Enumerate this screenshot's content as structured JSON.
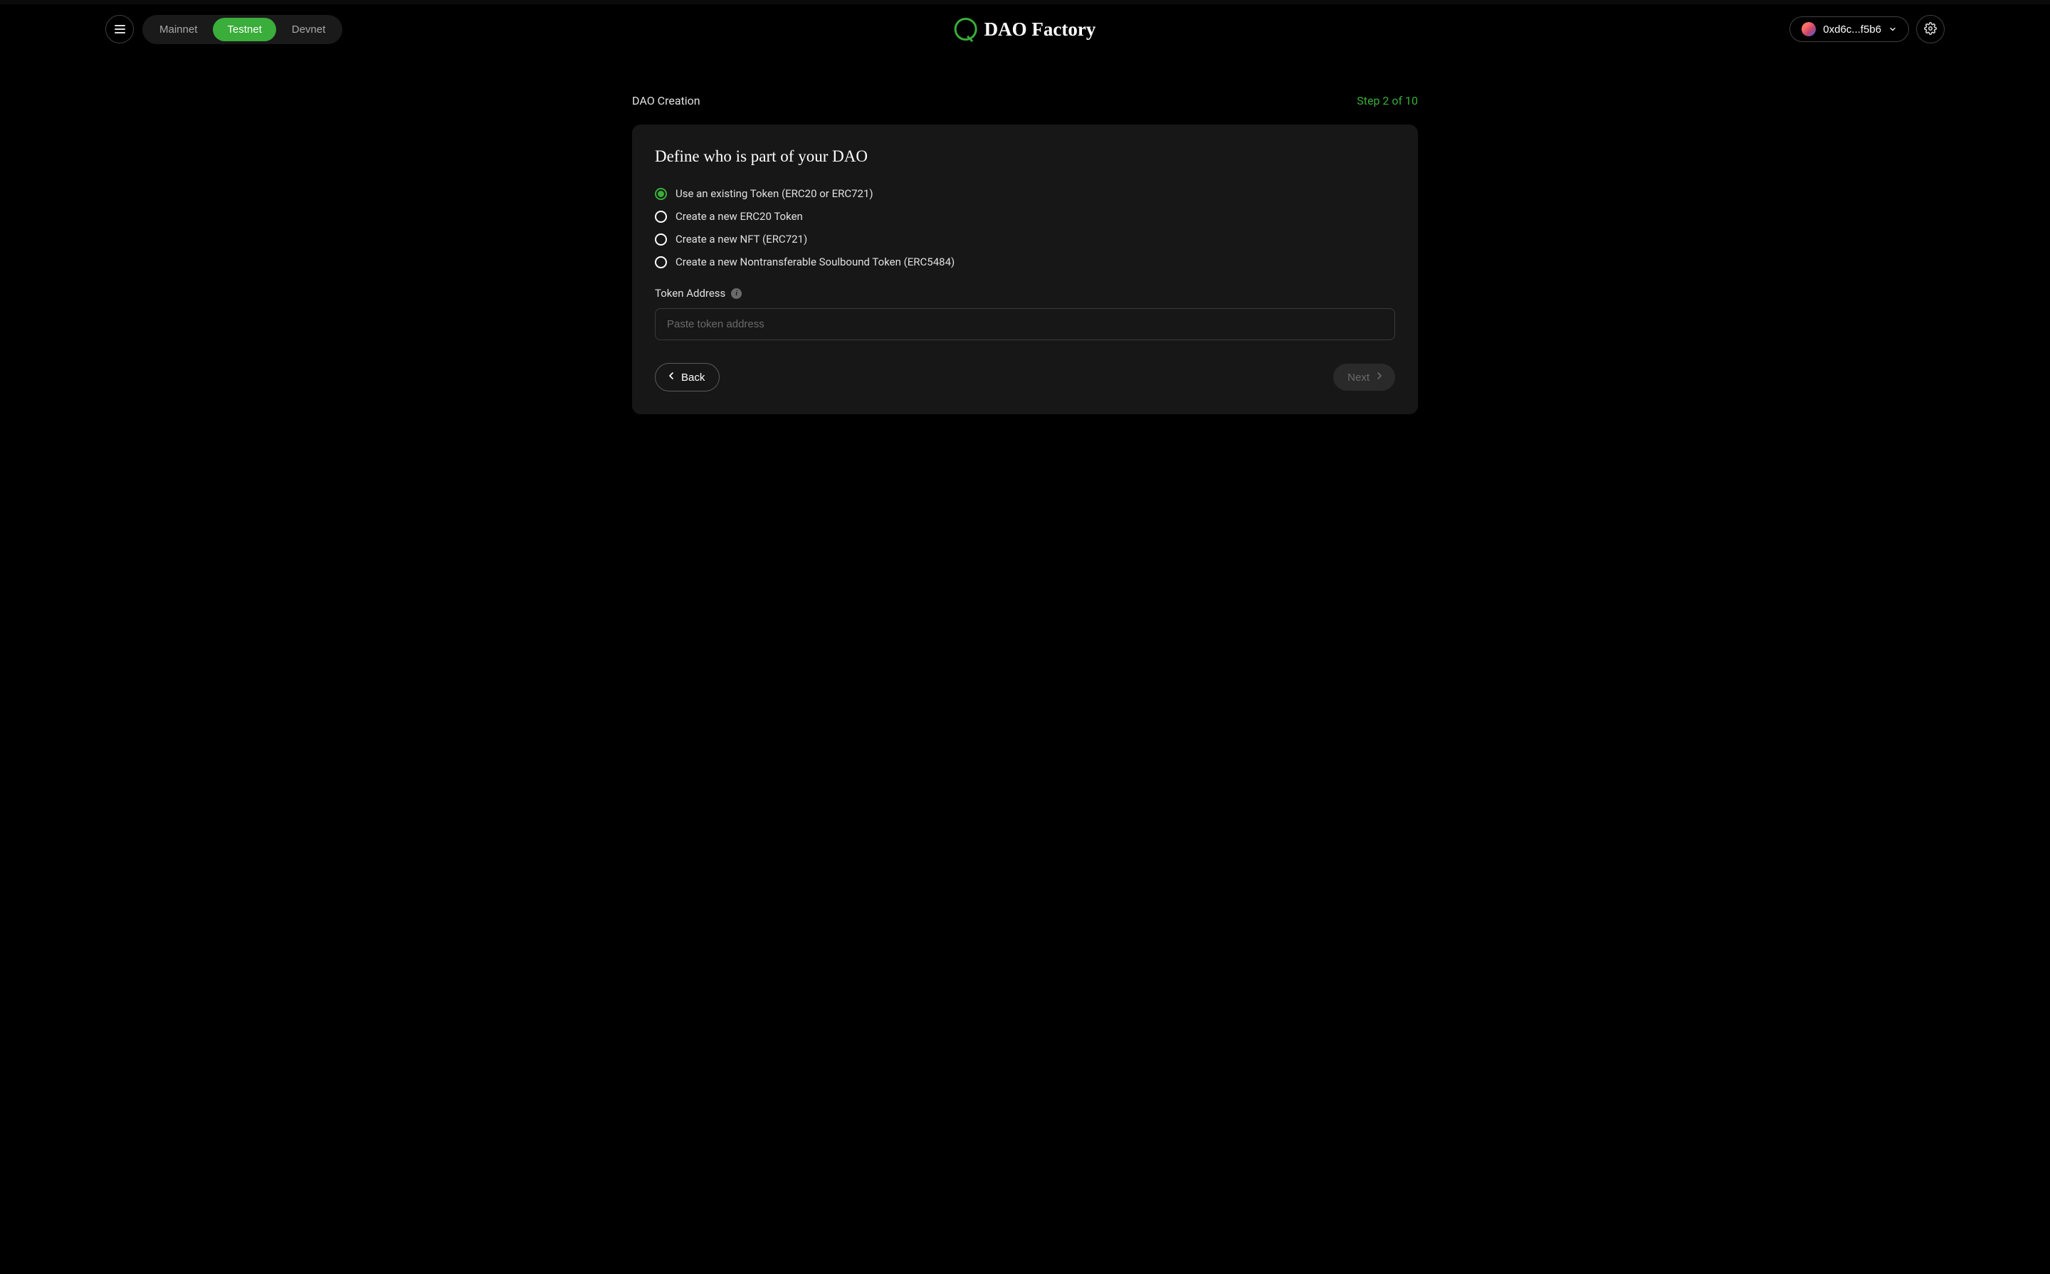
{
  "header": {
    "networks": {
      "mainnet": "Mainnet",
      "testnet": "Testnet",
      "devnet": "Devnet"
    },
    "app_title": "DAO Factory",
    "wallet_address": "0xd6c...f5b6"
  },
  "page": {
    "title": "DAO Creation",
    "step_text": "Step 2 of 10"
  },
  "card": {
    "title": "Define who is part of your DAO",
    "radio_options": {
      "existing": "Use an existing Token (ERC20 or ERC721)",
      "erc20": "Create a new ERC20 Token",
      "nft": "Create a new NFT (ERC721)",
      "soulbound": "Create a new Nontransferable Soulbound Token (ERC5484)"
    },
    "token_address_label": "Token Address",
    "token_address_placeholder": "Paste token address",
    "back_label": "Back",
    "next_label": "Next"
  }
}
